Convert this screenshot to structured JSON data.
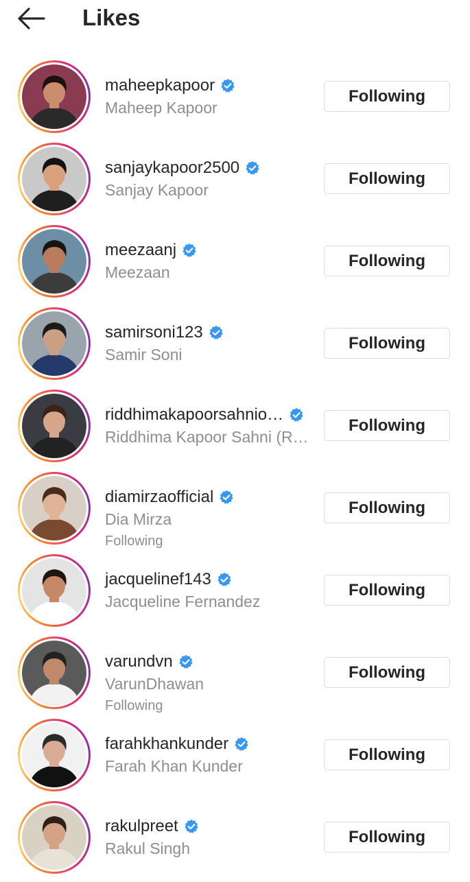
{
  "header": {
    "title": "Likes",
    "back_icon": "arrow-left-icon"
  },
  "colors": {
    "text_primary": "#262626",
    "text_secondary": "#8e8e8e",
    "verified_blue": "#3897f0",
    "button_border": "#dbdbdb",
    "ring_gradient": [
      "#feda77",
      "#f58529",
      "#dd2a7b",
      "#8134af"
    ]
  },
  "users": [
    {
      "username": "maheepkapoor",
      "full_name": "Maheep Kapoor",
      "verified": true,
      "button": "Following",
      "subtitle": ""
    },
    {
      "username": "sanjaykapoor2500",
      "full_name": "Sanjay Kapoor",
      "verified": true,
      "button": "Following",
      "subtitle": ""
    },
    {
      "username": "meezaanj",
      "full_name": "Meezaan",
      "verified": true,
      "button": "Following",
      "subtitle": ""
    },
    {
      "username": "samirsoni123",
      "full_name": "Samir Soni",
      "verified": true,
      "button": "Following",
      "subtitle": ""
    },
    {
      "username": "riddhimakapoorsahnio…",
      "full_name": "Riddhima Kapoor Sahni (R…",
      "verified": true,
      "button": "Following",
      "subtitle": ""
    },
    {
      "username": "diamirzaofficial",
      "full_name": "Dia Mirza",
      "verified": true,
      "button": "Following",
      "subtitle": "Following"
    },
    {
      "username": "jacquelinef143",
      "full_name": "Jacqueline Fernandez",
      "verified": true,
      "button": "Following",
      "subtitle": ""
    },
    {
      "username": "varundvn",
      "full_name": "VarunDhawan",
      "verified": true,
      "button": "Following",
      "subtitle": "Following"
    },
    {
      "username": "farahkhankunder",
      "full_name": "Farah Khan Kunder",
      "verified": true,
      "button": "Following",
      "subtitle": ""
    },
    {
      "username": "rakulpreet",
      "full_name": "Rakul Singh",
      "verified": true,
      "button": "Following",
      "subtitle": ""
    }
  ]
}
